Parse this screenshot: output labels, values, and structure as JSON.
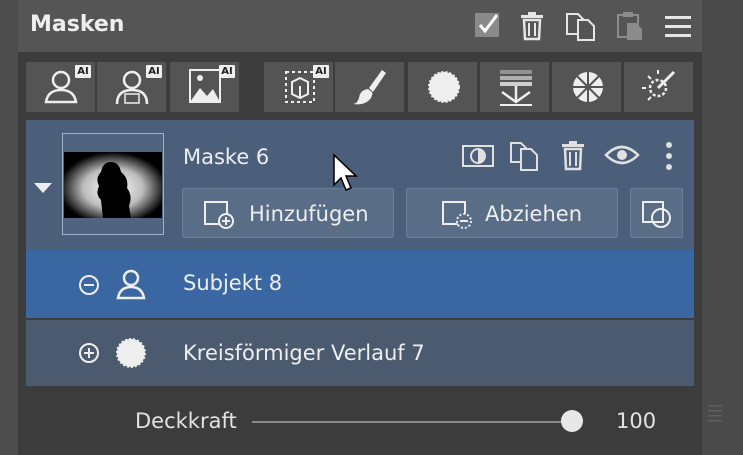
{
  "panel": {
    "title": "Masken"
  },
  "header_icons": [
    "checkbox-checked-icon",
    "trash-icon",
    "copy-icon",
    "paste-icon",
    "hamburger-menu-icon"
  ],
  "toolbar": {
    "ai_badge": "AI",
    "tools": [
      "subject-ai-icon",
      "person-ai-icon",
      "landscape-ai-icon",
      "object-select-ai-icon",
      "brush-icon",
      "radial-gradient-icon",
      "linear-gradient-icon",
      "color-wheel-icon",
      "magic-wand-icon"
    ]
  },
  "mask": {
    "name": "Maske 6",
    "actions": [
      "invert-mask-icon",
      "duplicate-icon",
      "trash-icon",
      "eye-icon",
      "more-vertical-icon"
    ],
    "add_label": "Hinzufügen",
    "subtract_label": "Abziehen"
  },
  "components": [
    {
      "mode": "subtract",
      "icon": "subject-icon",
      "label": "Subjekt 8",
      "selected": true
    },
    {
      "mode": "add",
      "icon": "radial-icon",
      "label": "Kreisförmiger Verlauf 7",
      "selected": false
    }
  ],
  "opacity": {
    "label": "Deckkraft",
    "value": "100",
    "fraction": 1.0
  },
  "colors": {
    "accent": "#3a67a1",
    "mask_bg": "#4b5f7a",
    "panel_bg": "#3c3c3c"
  }
}
